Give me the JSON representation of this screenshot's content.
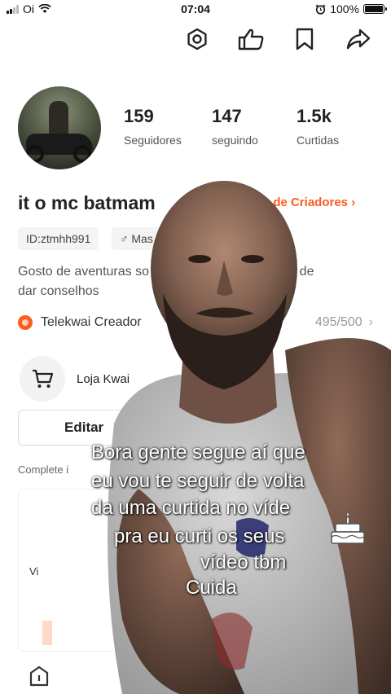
{
  "status_bar": {
    "carrier": "Oi",
    "time": "07:04",
    "battery": "100%",
    "battery_level": 1.0
  },
  "top_actions": [
    {
      "icon": "hexagon-settings-icon"
    },
    {
      "icon": "thumb-like-icon"
    },
    {
      "icon": "bookmark-icon"
    },
    {
      "icon": "share-arrow-icon"
    }
  ],
  "profile": {
    "stats": [
      {
        "value": "159",
        "label": "Seguidores"
      },
      {
        "value": "147",
        "label": "seguindo"
      },
      {
        "value": "1.5k",
        "label": "Curtidas"
      }
    ],
    "name": "it o mc batmam",
    "creators_link": "ntro de Criadores",
    "id_tag": "ID:ztmhh991",
    "gender_tag": "Mas",
    "bio_line1": "Gosto de aventuras so",
    "bio_line1_end": "osto de",
    "bio_line2": "dar conselhos"
  },
  "creator": {
    "label": "Telekwai Creador",
    "count": "495/500"
  },
  "shop": {
    "label": "Loja Kwai"
  },
  "edit_button": {
    "label": "Editar",
    "ghost": "os"
  },
  "complete": {
    "label": "Complete i",
    "card_label": "Vi"
  },
  "caption": {
    "line1": "Bora gente segue aí que",
    "line2": "eu vou te seguir de volta",
    "line3": "da uma curtida no víde",
    "line4": "pra eu curti os seus",
    "line5": "vídeo tbm",
    "line6": "Cuida"
  },
  "colors": {
    "accent": "#ff5b1f"
  }
}
